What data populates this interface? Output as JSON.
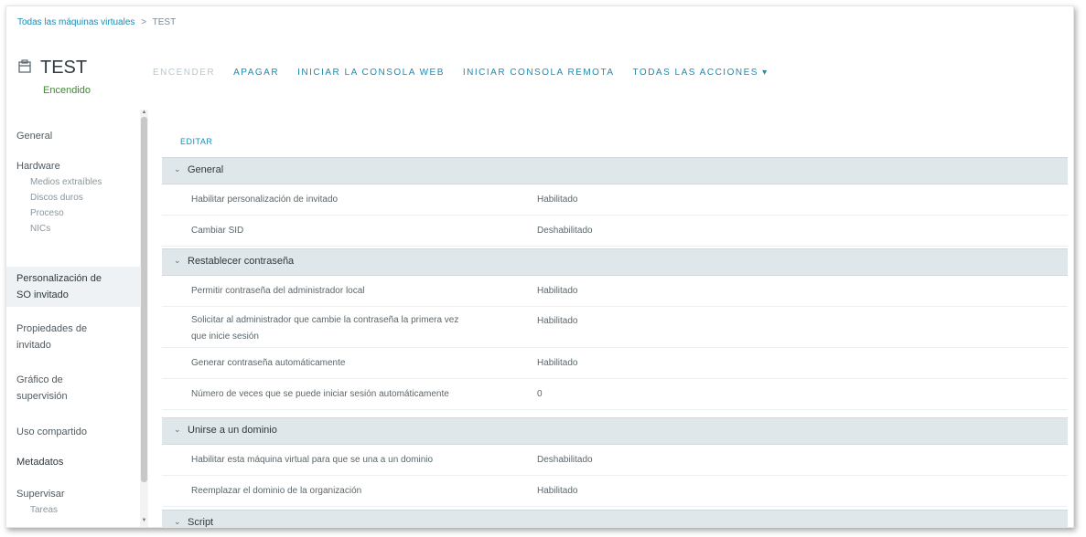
{
  "breadcrumb": {
    "parent": "Todas las máquinas virtuales",
    "separator": ">",
    "current": "TEST"
  },
  "vm": {
    "name": "TEST",
    "status": "Encendido",
    "status_color": "#3b8a2c"
  },
  "actions": [
    {
      "label": "ENCENDER",
      "enabled": false
    },
    {
      "label": "APAGAR",
      "enabled": true
    },
    {
      "label": "INICIAR LA CONSOLA WEB",
      "enabled": true
    },
    {
      "label": "INICIAR CONSOLA REMOTA",
      "enabled": true
    },
    {
      "label": "TODAS LAS ACCIONES ▾",
      "enabled": true
    }
  ],
  "sidebar": {
    "general": "General",
    "hardware": "Hardware",
    "hw_items": [
      "Medios extraíbles",
      "Discos duros",
      "Proceso",
      "NICs"
    ],
    "customization": [
      "Personalización de",
      "SO invitado"
    ],
    "guest_props": [
      "Propiedades de",
      "invitado"
    ],
    "monitoring": [
      "Gráfico de",
      "supervisión"
    ],
    "sharing": "Uso compartido",
    "metadata": "Metadatos",
    "supervise": "Supervisar",
    "tasks": "Tareas"
  },
  "content": {
    "edit": "EDITAR",
    "sections": [
      {
        "title": "General",
        "rows": [
          {
            "key": "Habilitar personalización de invitado",
            "value": "Habilitado"
          },
          {
            "key": "Cambiar SID",
            "value": "Deshabilitado"
          }
        ]
      },
      {
        "title": "Restablecer contraseña",
        "rows": [
          {
            "key": "Permitir contraseña del administrador local",
            "value": "Habilitado"
          },
          {
            "key": "Solicitar al administrador que cambie la contraseña la primera vez",
            "key2": "que inicie sesión",
            "value": "Habilitado"
          },
          {
            "key": "Generar contraseña automáticamente",
            "value": "Habilitado"
          },
          {
            "key": "Número de veces que se puede iniciar sesión automáticamente",
            "value": "0"
          }
        ]
      },
      {
        "title": "Unirse a un dominio",
        "rows": [
          {
            "key": "Habilitar esta máquina virtual para que se una a un dominio",
            "value": "Deshabilitado"
          },
          {
            "key": "Reemplazar el dominio de la organización",
            "value": "Habilitado"
          }
        ]
      },
      {
        "title": "Script",
        "rows": []
      }
    ]
  }
}
